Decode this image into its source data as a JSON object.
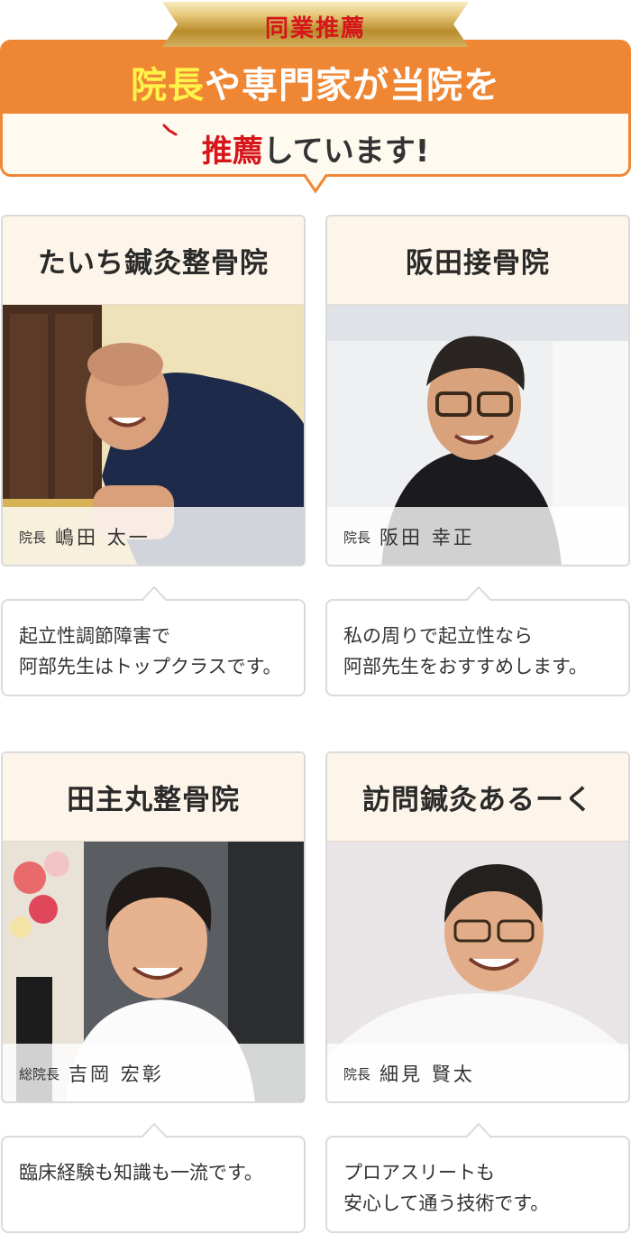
{
  "header": {
    "ribbon": "同業推薦",
    "line1_highlight": "院長",
    "line1_rest": "や専門家が当院を",
    "line2_highlight": "推薦",
    "line2_rest": "しています!"
  },
  "colors": {
    "orange": "#ef8634",
    "red": "#d6161b",
    "yellow": "#fff34a",
    "gold": "#c9a24a"
  },
  "cards": [
    {
      "clinic": "たいち鍼灸整骨院",
      "role": "院長",
      "name": "嶋田 太一",
      "comment": [
        "起立性調節障害で",
        "阿部先生はトップクラスです。"
      ]
    },
    {
      "clinic": "阪田接骨院",
      "role": "院長",
      "name": "阪田 幸正",
      "comment": [
        "私の周りで起立性なら",
        "阿部先生をおすすめします。"
      ]
    },
    {
      "clinic": "田主丸整骨院",
      "role": "総院長",
      "name": "吉岡 宏彰",
      "comment": [
        "臨床経験も知識も一流です。"
      ]
    },
    {
      "clinic": "訪問鍼灸あるーく",
      "role": "院長",
      "name": "細見 賢太",
      "comment": [
        "プロアスリートも",
        "安心して通う技術です。"
      ]
    }
  ]
}
